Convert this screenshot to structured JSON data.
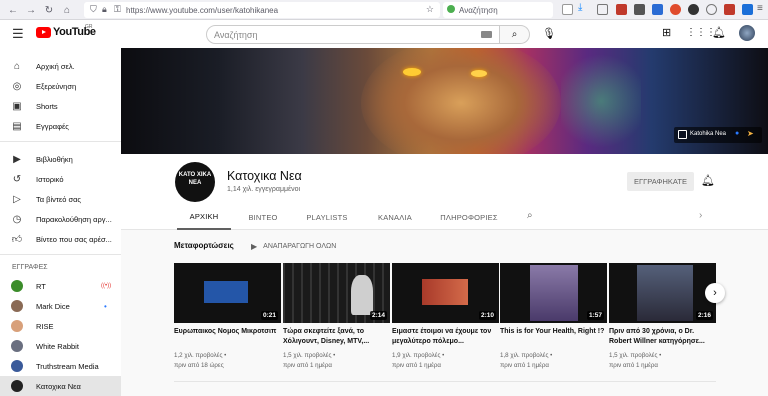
{
  "browser": {
    "url": "https://www.youtube.com/user/katohikanea",
    "search_placeholder": "Αναζήτηση"
  },
  "header": {
    "logo_text": "YouTube",
    "logo_region": "GR",
    "search_placeholder": "Αναζήτηση"
  },
  "sidebar": {
    "items": [
      {
        "label": "Αρχική σελ.",
        "icon": "home-icon"
      },
      {
        "label": "Εξερεύνηση",
        "icon": "compass-icon"
      },
      {
        "label": "Shorts",
        "icon": "shorts-icon"
      },
      {
        "label": "Εγγραφές",
        "icon": "subscriptions-icon"
      },
      {
        "label": "Βιβλιοθήκη",
        "icon": "library-icon"
      },
      {
        "label": "Ιστορικό",
        "icon": "history-icon"
      },
      {
        "label": "Τα βίντεό σας",
        "icon": "play-icon"
      },
      {
        "label": "Παρακολούθηση αργ...",
        "icon": "clock-icon"
      },
      {
        "label": "Βίντεο που σας αρέσ...",
        "icon": "thumbs-up-icon"
      }
    ],
    "subs_heading": "ΕΓΓΡΑΦΕΣ",
    "subs": [
      {
        "label": "RT",
        "color": "#3b8c2a",
        "badge": "((•))"
      },
      {
        "label": "Mark Dice",
        "color": "#8a6a55",
        "badge": "•"
      },
      {
        "label": "RISE",
        "color": "#d8a07a",
        "badge": ""
      },
      {
        "label": "White Rabbit",
        "color": "#6a6f80",
        "badge": ""
      },
      {
        "label": "Truthstream Media",
        "color": "#3a5a9a",
        "badge": ""
      },
      {
        "label": "Κατοχικα Νεα",
        "color": "#222222",
        "badge": ""
      }
    ]
  },
  "banner": {
    "link_label": "Katohika Nea"
  },
  "channel": {
    "name": "Κατοχικα Νεα",
    "subscribers": "1,14 χιλ. εγγεγραμμένοι",
    "subscribe_label": "ΕΓΓΡΑΦΗΚΑΤΕ",
    "avatar_text": "ΚΑΤΟ ΧΙΚΑ ΝΕΑ"
  },
  "tabs": [
    {
      "label": "ΑΡΧΙΚΗ",
      "active": true
    },
    {
      "label": "ΒΙΝΤΕΟ",
      "active": false
    },
    {
      "label": "PLAYLISTS",
      "active": false
    },
    {
      "label": "ΚΑΝΑΛΙΑ",
      "active": false
    },
    {
      "label": "ΠΛΗΡΟΦΟΡΙΕΣ",
      "active": false
    }
  ],
  "shelf": {
    "title": "Μεταφορτώσεις",
    "play_all": "ΑΝΑΠΑΡΑΓΩΓΗ ΟΛΩΝ"
  },
  "videos": [
    {
      "title": "Ευρωπαικος Νομος Μικροτσιπ",
      "duration": "0:21",
      "views": "1,2 χιλ. προβολές",
      "age": "πριν από 18 ώρες"
    },
    {
      "title": "Τώρα σκεφτείτε ξανά, το Χόλιγουντ, Disney, MTV,...",
      "duration": "2:14",
      "views": "1,5 χιλ. προβολές",
      "age": "πριν από 1 ημέρα"
    },
    {
      "title": "Ειμαστε έτοιμοι να έχουμε τον μεγαλύτερο πόλεμο...",
      "duration": "2:10",
      "views": "1,9 χιλ. προβολές",
      "age": "πριν από 1 ημέρα"
    },
    {
      "title": "This is for Your Health, Right !?",
      "duration": "1:57",
      "views": "1,8 χιλ. προβολές",
      "age": "πριν από 1 ημέρα"
    },
    {
      "title": "Πριν από 30 χρόνια, ο Dr. Robert Willner κατηγόρησε...",
      "duration": "2:16",
      "views": "1,5 χιλ. προβολές",
      "age": "πριν από 1 ημέρα"
    }
  ]
}
